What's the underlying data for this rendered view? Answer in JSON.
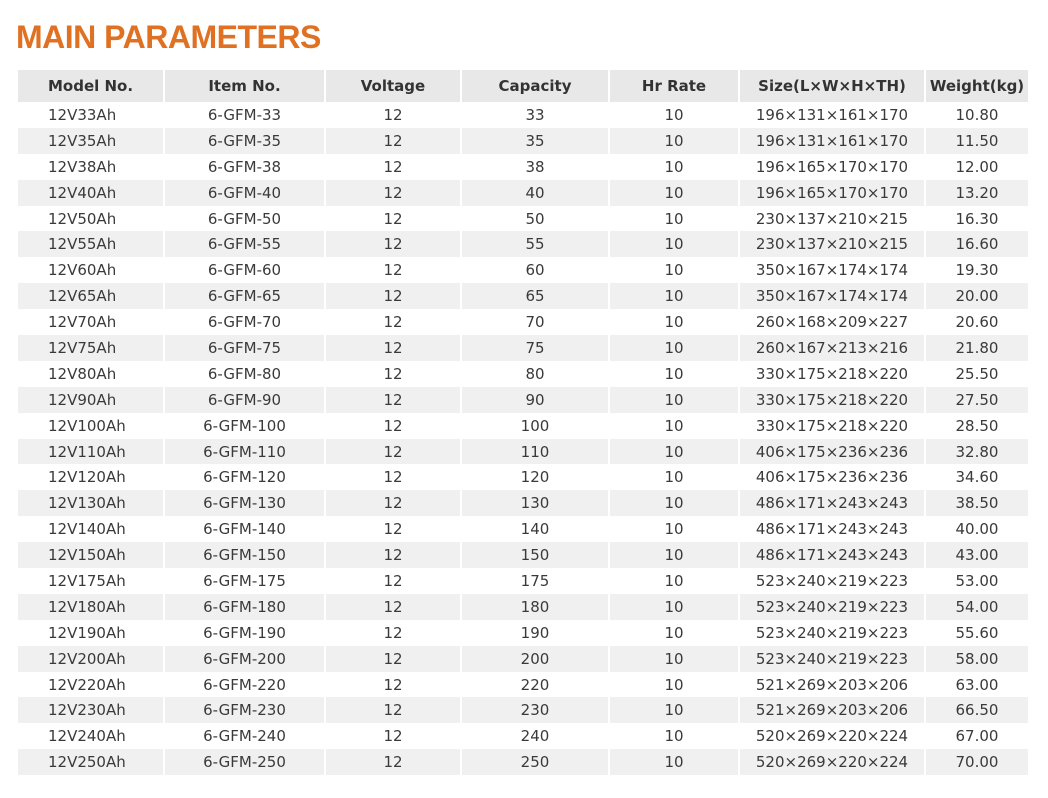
{
  "page": {
    "title": "MAIN PARAMETERS",
    "accent_color": "#e07022",
    "header_bg": "#e8e8e8",
    "stripe_bg": "#f0f0f0"
  },
  "table": {
    "headers": [
      "Model No.",
      "Item No.",
      "Voltage",
      "Capacity",
      "Hr Rate",
      "Size(L×W×H×TH)",
      "Weight(kg)"
    ],
    "rows": [
      [
        "12V33Ah",
        "6-GFM-33",
        "12",
        "33",
        "10",
        "196×131×161×170",
        "10.80"
      ],
      [
        "12V35Ah",
        "6-GFM-35",
        "12",
        "35",
        "10",
        "196×131×161×170",
        "11.50"
      ],
      [
        "12V38Ah",
        "6-GFM-38",
        "12",
        "38",
        "10",
        "196×165×170×170",
        "12.00"
      ],
      [
        "12V40Ah",
        "6-GFM-40",
        "12",
        "40",
        "10",
        "196×165×170×170",
        "13.20"
      ],
      [
        "12V50Ah",
        "6-GFM-50",
        "12",
        "50",
        "10",
        "230×137×210×215",
        "16.30"
      ],
      [
        "12V55Ah",
        "6-GFM-55",
        "12",
        "55",
        "10",
        "230×137×210×215",
        "16.60"
      ],
      [
        "12V60Ah",
        "6-GFM-60",
        "12",
        "60",
        "10",
        "350×167×174×174",
        "19.30"
      ],
      [
        "12V65Ah",
        "6-GFM-65",
        "12",
        "65",
        "10",
        "350×167×174×174",
        "20.00"
      ],
      [
        "12V70Ah",
        "6-GFM-70",
        "12",
        "70",
        "10",
        "260×168×209×227",
        "20.60"
      ],
      [
        "12V75Ah",
        "6-GFM-75",
        "12",
        "75",
        "10",
        "260×167×213×216",
        "21.80"
      ],
      [
        "12V80Ah",
        "6-GFM-80",
        "12",
        "80",
        "10",
        "330×175×218×220",
        "25.50"
      ],
      [
        "12V90Ah",
        "6-GFM-90",
        "12",
        "90",
        "10",
        "330×175×218×220",
        "27.50"
      ],
      [
        "12V100Ah",
        "6-GFM-100",
        "12",
        "100",
        "10",
        "330×175×218×220",
        "28.50"
      ],
      [
        "12V110Ah",
        "6-GFM-110",
        "12",
        "110",
        "10",
        "406×175×236×236",
        "32.80"
      ],
      [
        "12V120Ah",
        "6-GFM-120",
        "12",
        "120",
        "10",
        "406×175×236×236",
        "34.60"
      ],
      [
        "12V130Ah",
        "6-GFM-130",
        "12",
        "130",
        "10",
        "486×171×243×243",
        "38.50"
      ],
      [
        "12V140Ah",
        "6-GFM-140",
        "12",
        "140",
        "10",
        "486×171×243×243",
        "40.00"
      ],
      [
        "12V150Ah",
        "6-GFM-150",
        "12",
        "150",
        "10",
        "486×171×243×243",
        "43.00"
      ],
      [
        "12V175Ah",
        "6-GFM-175",
        "12",
        "175",
        "10",
        "523×240×219×223",
        "53.00"
      ],
      [
        "12V180Ah",
        "6-GFM-180",
        "12",
        "180",
        "10",
        "523×240×219×223",
        "54.00"
      ],
      [
        "12V190Ah",
        "6-GFM-190",
        "12",
        "190",
        "10",
        "523×240×219×223",
        "55.60"
      ],
      [
        "12V200Ah",
        "6-GFM-200",
        "12",
        "200",
        "10",
        "523×240×219×223",
        "58.00"
      ],
      [
        "12V220Ah",
        "6-GFM-220",
        "12",
        "220",
        "10",
        "521×269×203×206",
        "63.00"
      ],
      [
        "12V230Ah",
        "6-GFM-230",
        "12",
        "230",
        "10",
        "521×269×203×206",
        "66.50"
      ],
      [
        "12V240Ah",
        "6-GFM-240",
        "12",
        "240",
        "10",
        "520×269×220×224",
        "67.00"
      ],
      [
        "12V250Ah",
        "6-GFM-250",
        "12",
        "250",
        "10",
        "520×269×220×224",
        "70.00"
      ]
    ]
  }
}
